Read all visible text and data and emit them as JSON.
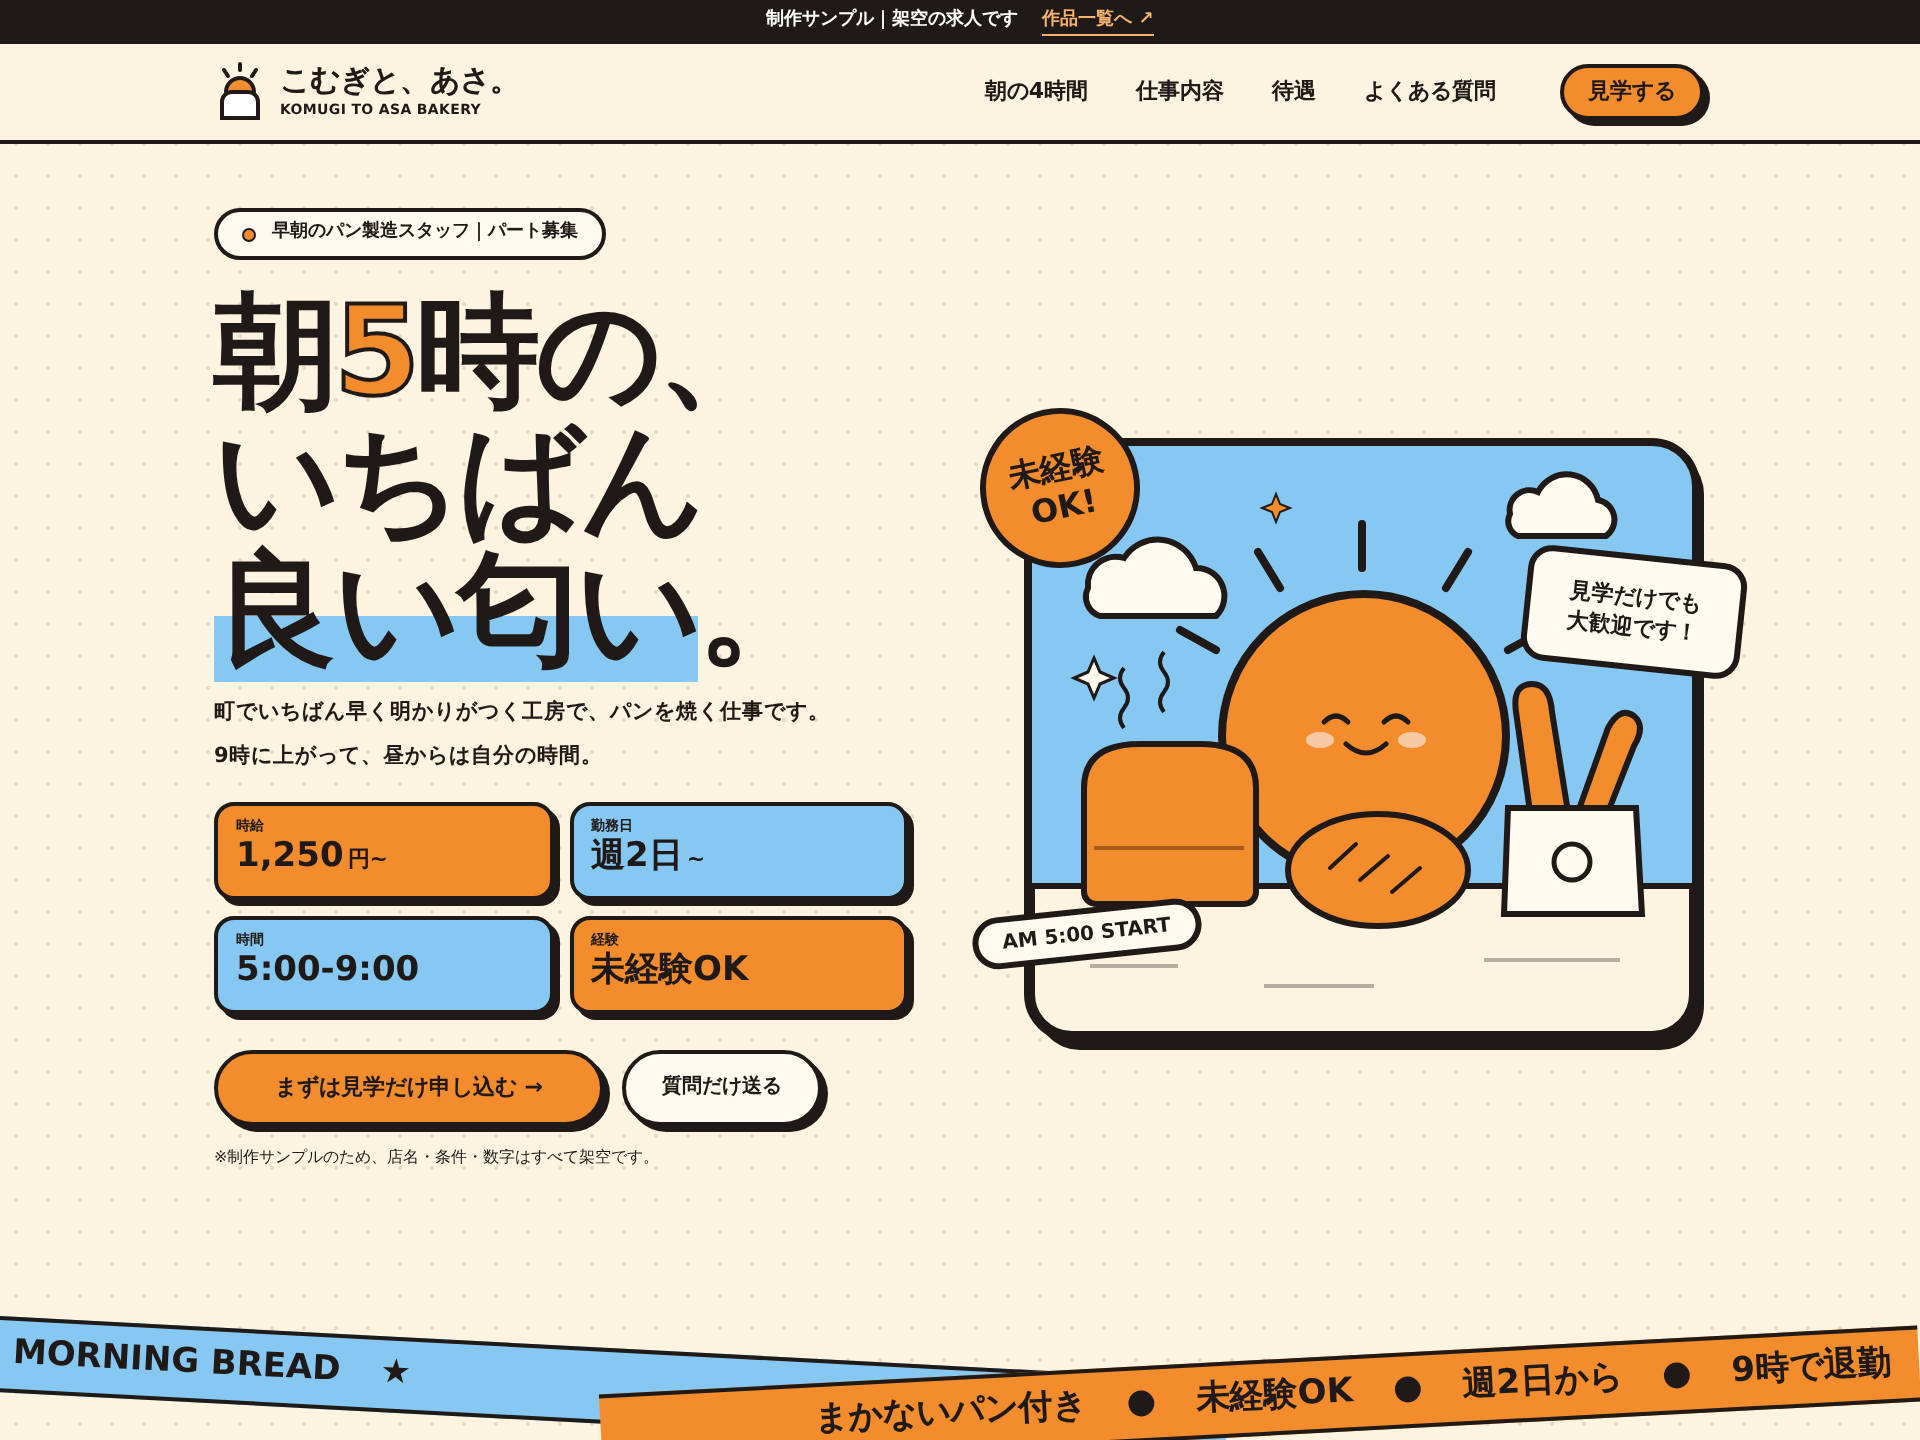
{
  "notice_bar": {
    "text": "制作サンプル｜架空の求人です",
    "link": "作品一覧へ ↗"
  },
  "header": {
    "logo_name": "こむぎと、あさ。",
    "logo_sub": "KOMUGI TO ASA BAKERY",
    "nav": [
      "朝の4時間",
      "仕事内容",
      "待遇",
      "よくある質問"
    ],
    "cta": "見学する"
  },
  "hero": {
    "tag": "早朝のパン製造スタッフ｜パート募集",
    "headline": [
      [
        {
          "text": "朝",
          "accent": false,
          "highlight": false
        },
        {
          "text": "5",
          "accent": true,
          "highlight": false
        },
        {
          "text": "時の、",
          "accent": false,
          "highlight": false
        }
      ],
      [
        {
          "text": "いちばん",
          "accent": false,
          "highlight": false
        }
      ],
      [
        {
          "text": "良い匂い",
          "accent": false,
          "highlight": true
        },
        {
          "text": "。",
          "accent": false,
          "highlight": false
        }
      ]
    ],
    "lead": [
      "町でいちばん早く明かりがつく工房で、パンを焼く仕事です。",
      "9時に上がって、昼からは自分の時間。"
    ],
    "cards": [
      {
        "label": "時給",
        "value": "1,250",
        "unit": "円~",
        "color": "#f28c2c"
      },
      {
        "label": "勤務日",
        "value": "週2日",
        "unit": "~",
        "color": "#86c8f2"
      },
      {
        "label": "時間",
        "value": "5:00-9:00",
        "color": "#86c8f2"
      },
      {
        "label": "経験",
        "value": "未経験OK",
        "color": "#f28c2c"
      }
    ],
    "primary_button": "まずは見学だけ申し込む →",
    "secondary_button": "質問だけ送る",
    "note": "※制作サンプルのため、店名・条件・数字はすべて架空です。"
  },
  "illustration": {
    "badge": "未経験OK!",
    "bubble": [
      "見学だけでも",
      "大歓迎です！"
    ],
    "start_tag": "AM 5:00 START"
  },
  "ribbons": [
    {
      "color": "#86c8f2",
      "items": [
        "MORNING BREAD",
        "★"
      ]
    },
    {
      "color": "#f28c2c",
      "items": [
        "まかないパン付き",
        "●",
        "未経験OK",
        "●",
        "週2日から",
        "●",
        "9時で退勤"
      ]
    }
  ]
}
